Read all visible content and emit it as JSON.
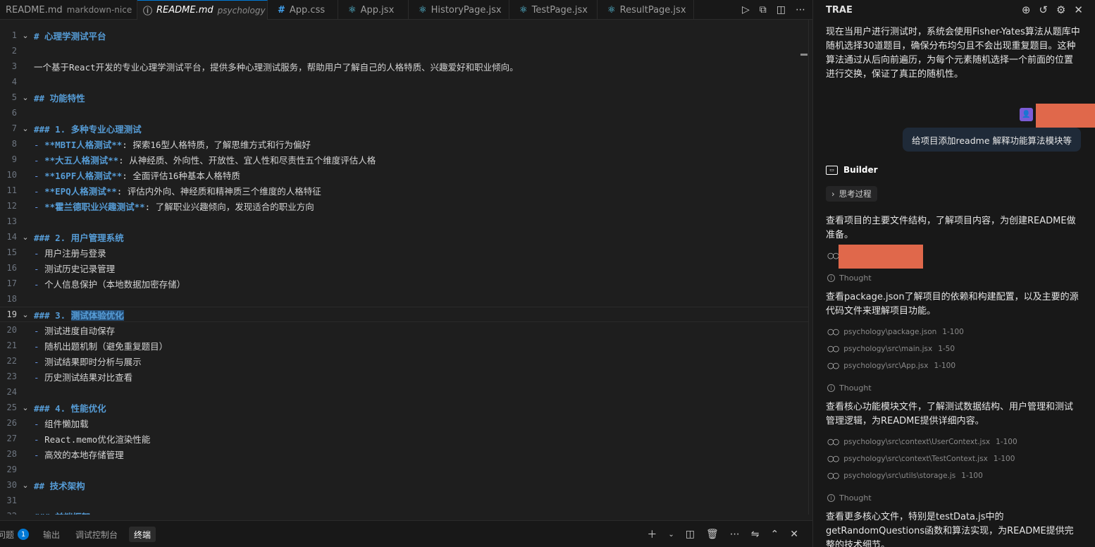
{
  "tabs": [
    {
      "name": "README.md",
      "desc": "markdown-nice",
      "active": false,
      "icon": "md"
    },
    {
      "name": "README.md",
      "desc": "psychology",
      "active": true,
      "icon": "md"
    },
    {
      "name": "App.css",
      "desc": "",
      "active": false,
      "icon": "css"
    },
    {
      "name": "App.jsx",
      "desc": "",
      "active": false,
      "icon": "react"
    },
    {
      "name": "HistoryPage.jsx",
      "desc": "",
      "active": false,
      "icon": "react"
    },
    {
      "name": "TestPage.jsx",
      "desc": "",
      "active": false,
      "icon": "react"
    },
    {
      "name": "ResultPage.jsx",
      "desc": "",
      "active": false,
      "icon": "react"
    }
  ],
  "editor": {
    "current_line": 19,
    "lines": [
      {
        "n": "1",
        "fold": true,
        "parts": [
          {
            "t": "# 心理学测试平台",
            "c": "h"
          }
        ]
      },
      {
        "n": "2",
        "fold": false,
        "parts": []
      },
      {
        "n": "3",
        "fold": false,
        "parts": [
          {
            "t": "一个基于React开发的专业心理学测试平台，提供多种心理测试服务，帮助用户了解自己的人格特质、兴趣爱好和职业倾向。",
            "c": ""
          }
        ]
      },
      {
        "n": "4",
        "fold": false,
        "parts": []
      },
      {
        "n": "5",
        "fold": true,
        "parts": [
          {
            "t": "## 功能特性",
            "c": "h"
          }
        ]
      },
      {
        "n": "6",
        "fold": false,
        "parts": []
      },
      {
        "n": "7",
        "fold": true,
        "parts": [
          {
            "t": "### 1. 多种专业心理测试",
            "c": "h"
          }
        ]
      },
      {
        "n": "8",
        "fold": false,
        "parts": [
          {
            "t": "- ",
            "c": "dash"
          },
          {
            "t": "**MBTI人格测试**",
            "c": "b"
          },
          {
            "t": ": 探索16型人格特质，了解思维方式和行为偏好",
            "c": ""
          }
        ]
      },
      {
        "n": "9",
        "fold": false,
        "parts": [
          {
            "t": "- ",
            "c": "dash"
          },
          {
            "t": "**大五人格测试**",
            "c": "b"
          },
          {
            "t": ": 从神经质、外向性、开放性、宜人性和尽责性五个维度评估人格",
            "c": ""
          }
        ]
      },
      {
        "n": "10",
        "fold": false,
        "parts": [
          {
            "t": "- ",
            "c": "dash"
          },
          {
            "t": "**16PF人格测试**",
            "c": "b"
          },
          {
            "t": ": 全面评估16种基本人格特质",
            "c": ""
          }
        ]
      },
      {
        "n": "11",
        "fold": false,
        "parts": [
          {
            "t": "- ",
            "c": "dash"
          },
          {
            "t": "**EPQ人格测试**",
            "c": "b"
          },
          {
            "t": ": 评估内外向、神经质和精神质三个维度的人格特征",
            "c": ""
          }
        ]
      },
      {
        "n": "12",
        "fold": false,
        "parts": [
          {
            "t": "- ",
            "c": "dash"
          },
          {
            "t": "**霍兰德职业兴趣测试**",
            "c": "b"
          },
          {
            "t": ": 了解职业兴趣倾向，发现适合的职业方向",
            "c": ""
          }
        ]
      },
      {
        "n": "13",
        "fold": false,
        "parts": []
      },
      {
        "n": "14",
        "fold": true,
        "parts": [
          {
            "t": "### 2. 用户管理系统",
            "c": "h"
          }
        ]
      },
      {
        "n": "15",
        "fold": false,
        "parts": [
          {
            "t": "- ",
            "c": "dash"
          },
          {
            "t": "用户注册与登录",
            "c": ""
          }
        ]
      },
      {
        "n": "16",
        "fold": false,
        "parts": [
          {
            "t": "- ",
            "c": "dash"
          },
          {
            "t": "测试历史记录管理",
            "c": ""
          }
        ]
      },
      {
        "n": "17",
        "fold": false,
        "parts": [
          {
            "t": "- ",
            "c": "dash"
          },
          {
            "t": "个人信息保护（本地数据加密存储）",
            "c": ""
          }
        ]
      },
      {
        "n": "18",
        "fold": false,
        "parts": []
      },
      {
        "n": "19",
        "fold": true,
        "parts": [
          {
            "t": "### 3. ",
            "c": "h"
          },
          {
            "t": "测试体验优化",
            "c": "h sel"
          }
        ]
      },
      {
        "n": "20",
        "fold": false,
        "parts": [
          {
            "t": "- ",
            "c": "dash"
          },
          {
            "t": "测试进度自动保存",
            "c": ""
          }
        ]
      },
      {
        "n": "21",
        "fold": false,
        "parts": [
          {
            "t": "- ",
            "c": "dash"
          },
          {
            "t": "随机出题机制（避免重复题目）",
            "c": ""
          }
        ]
      },
      {
        "n": "22",
        "fold": false,
        "parts": [
          {
            "t": "- ",
            "c": "dash"
          },
          {
            "t": "测试结果即时分析与展示",
            "c": ""
          }
        ]
      },
      {
        "n": "23",
        "fold": false,
        "parts": [
          {
            "t": "- ",
            "c": "dash"
          },
          {
            "t": "历史测试结果对比查看",
            "c": ""
          }
        ]
      },
      {
        "n": "24",
        "fold": false,
        "parts": []
      },
      {
        "n": "25",
        "fold": true,
        "parts": [
          {
            "t": "### 4. 性能优化",
            "c": "h"
          }
        ]
      },
      {
        "n": "26",
        "fold": false,
        "parts": [
          {
            "t": "- ",
            "c": "dash"
          },
          {
            "t": "组件懒加载",
            "c": ""
          }
        ]
      },
      {
        "n": "27",
        "fold": false,
        "parts": [
          {
            "t": "- ",
            "c": "dash"
          },
          {
            "t": "React.memo优化渲染性能",
            "c": ""
          }
        ]
      },
      {
        "n": "28",
        "fold": false,
        "parts": [
          {
            "t": "- ",
            "c": "dash"
          },
          {
            "t": "高效的本地存储管理",
            "c": ""
          }
        ]
      },
      {
        "n": "29",
        "fold": false,
        "parts": []
      },
      {
        "n": "30",
        "fold": true,
        "parts": [
          {
            "t": "## 技术架构",
            "c": "h"
          }
        ]
      },
      {
        "n": "31",
        "fold": false,
        "parts": []
      },
      {
        "n": "32",
        "fold": false,
        "parts": [
          {
            "t": "### 前端框架",
            "c": "h"
          }
        ]
      }
    ]
  },
  "panel": {
    "tabs": [
      {
        "label": "问题",
        "badge": "1",
        "active": false
      },
      {
        "label": "输出",
        "badge": "",
        "active": false
      },
      {
        "label": "调试控制台",
        "badge": "",
        "active": false
      },
      {
        "label": "终端",
        "badge": "",
        "active": true
      }
    ]
  },
  "chat": {
    "title": "TRAE",
    "intro": "现在当用户进行测试时，系统会使用Fisher-Yates算法从题库中随机选择30道题目，确保分布均匀且不会出现重复题目。这种算法通过从后向前遍历，为每个元素随机选择一个前面的位置进行交换，保证了真正的随机性。",
    "user_message": "给项目添加readme 解释功能算法模块等",
    "agent_name": "Builder",
    "thinking_label": "思考过程",
    "steps": [
      "查看项目的主要文件结构，了解项目内容，为创建README做准备。",
      "查看package.json了解项目的依赖和构建配置，以及主要的源代码文件来理解项目功能。",
      "查看核心功能模块文件，了解测试数据结构、用户管理和测试管理逻辑，为README提供详细内容。",
      "查看更多核心文件，特别是testData.js中的getRandomQuestions函数和算法实现，为README提供完整的技术细节。"
    ],
    "thought_label": "Thought",
    "file_refs_a": [
      {
        "path": "psychology\\package.json",
        "range": "1-100"
      },
      {
        "path": "psychology\\src\\main.jsx",
        "range": "1-50"
      },
      {
        "path": "psychology\\src\\App.jsx",
        "range": "1-100"
      }
    ],
    "file_refs_b": [
      {
        "path": "psychology\\src\\context\\UserContext.jsx",
        "range": "1-100"
      },
      {
        "path": "psychology\\src\\context\\TestContext.jsx",
        "range": "1-100"
      },
      {
        "path": "psychology\\src\\utils\\storage.js",
        "range": "1-100"
      }
    ]
  },
  "colors": {
    "accent": "#0078d4",
    "heading": "#569cd6",
    "redaction": "#e0684b",
    "avatar": "#7b5cd6"
  }
}
